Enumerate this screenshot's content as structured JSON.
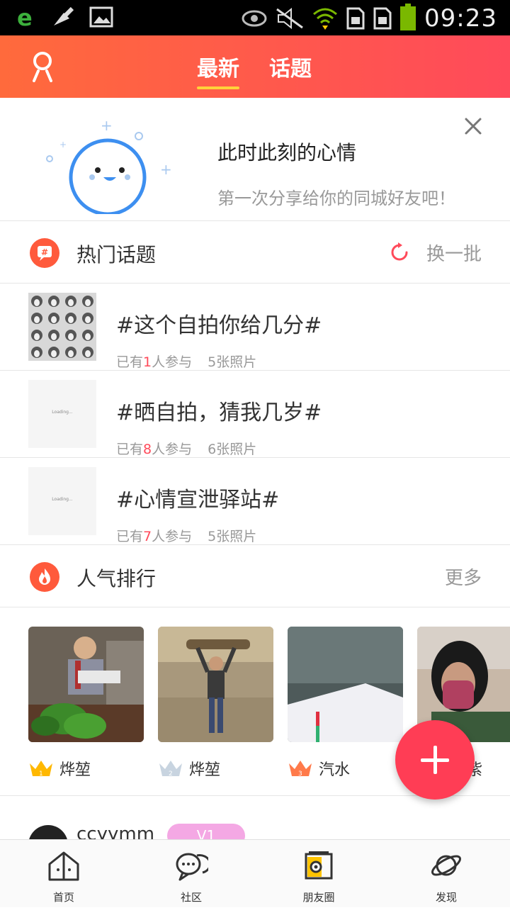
{
  "status_bar": {
    "time": "09:23"
  },
  "header": {
    "tabs": [
      {
        "label": "最新",
        "active": true
      },
      {
        "label": "话题",
        "active": false
      }
    ]
  },
  "mood_banner": {
    "title": "此时此刻的心情",
    "subtitle": "第一次分享给你的同城好友吧！"
  },
  "hot_topics": {
    "title": "热门话题",
    "action_label": "换一批",
    "items": [
      {
        "title": "#这个自拍你给几分#",
        "prefix": "已有",
        "count": "1",
        "suffix": "人参与",
        "photos": "5张照片",
        "thumb_text": ""
      },
      {
        "title": "#晒自拍，猜我几岁#",
        "prefix": "已有",
        "count": "8",
        "suffix": "人参与",
        "photos": "6张照片",
        "thumb_text": "Loading..."
      },
      {
        "title": "#心情宣泄驿站#",
        "prefix": "已有",
        "count": "7",
        "suffix": "人参与",
        "photos": "5张照片",
        "thumb_text": "Loading..."
      }
    ]
  },
  "popular_ranking": {
    "title": "人气排行",
    "action_label": "更多",
    "items": [
      {
        "name": "烨堃",
        "rank": "1"
      },
      {
        "name": "烨堃",
        "rank": "2"
      },
      {
        "name": "汽水",
        "rank": "3"
      },
      {
        "name": "紫",
        "rank": ""
      }
    ]
  },
  "feed_preview": {
    "username": "ccyymm",
    "badge": "V1"
  },
  "bottom_nav": {
    "items": [
      {
        "label": "首页",
        "icon": "home-icon"
      },
      {
        "label": "社区",
        "icon": "chat-bubbles-icon"
      },
      {
        "label": "朋友圈",
        "icon": "camera-icon"
      },
      {
        "label": "发现",
        "icon": "planet-icon"
      }
    ]
  },
  "colors": {
    "header_start": "#ff6a3c",
    "header_end": "#ff4a5a",
    "accent": "#ff3d55",
    "count_highlight": "#ff4a5a",
    "tab_underline": "#ffd23a"
  }
}
